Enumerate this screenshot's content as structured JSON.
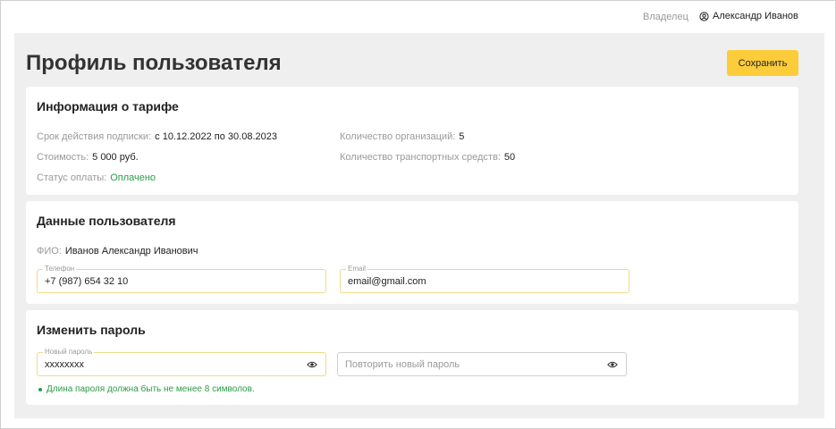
{
  "header": {
    "role": "Владелец",
    "user_name": "Александр Иванов"
  },
  "page": {
    "title": "Профиль пользователя",
    "save_label": "Сохранить"
  },
  "tariff": {
    "title": "Информация о тарифе",
    "period_label": "Срок действия подписки:",
    "period_value": "с 10.12.2022 по 30.08.2023",
    "cost_label": "Стоимость:",
    "cost_value": "5 000 руб.",
    "status_label": "Статус оплаты:",
    "status_value": "Оплачено",
    "orgs_label": "Количество организаций:",
    "orgs_value": "5",
    "vehicles_label": "Количество транспортных средств:",
    "vehicles_value": "50"
  },
  "user_data": {
    "title": "Данные пользователя",
    "fio_label": "ФИО:",
    "fio_value": "Иванов Александр Иванович",
    "phone_label": "Телефон",
    "phone_value": "+7 (987) 654 32 10",
    "email_label": "Email",
    "email_value": "email@gmail.com"
  },
  "password": {
    "title": "Изменить пароль",
    "new_label": "Новый пароль",
    "new_value": "xxxxxxxx",
    "repeat_placeholder": "Повторить новый пароль",
    "hint": "Длина пароля должна быть не менее 8 символов."
  },
  "colors": {
    "accent": "#fccc3a",
    "success": "#2a9d45",
    "background": "#efefef"
  }
}
